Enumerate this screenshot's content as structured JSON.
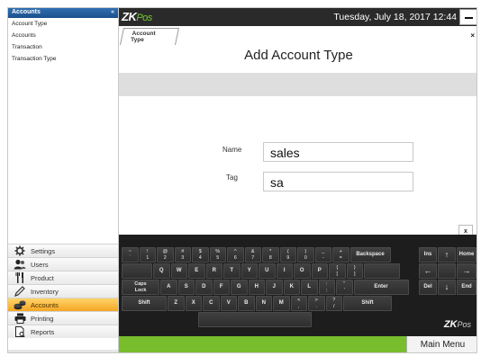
{
  "sidebar": {
    "title": "Accounts",
    "collapse_glyph": "«",
    "links": [
      "Account Type",
      "Accounts",
      "Transaction",
      "Transaction Type"
    ],
    "nav": [
      {
        "label": "Settings",
        "icon": "gear-icon",
        "active": false
      },
      {
        "label": "Users",
        "icon": "users-icon",
        "active": false
      },
      {
        "label": "Product",
        "icon": "fork-knife-icon",
        "active": false
      },
      {
        "label": "Inventory",
        "icon": "pencil-icon",
        "active": false
      },
      {
        "label": "Accounts",
        "icon": "coins-icon",
        "active": true
      },
      {
        "label": "Printing",
        "icon": "printer-icon",
        "active": false
      },
      {
        "label": "Reports",
        "icon": "report-icon",
        "active": false
      }
    ]
  },
  "topbar": {
    "logo_main": "ZK",
    "logo_accent": "Pos",
    "datetime": "Tuesday, July 18, 2017 12:44"
  },
  "content": {
    "tab_label_1": "Account",
    "tab_label_2": "Type",
    "close_tab": "×",
    "title": "Add Account Type",
    "name_label": "Name",
    "name_value": "sales",
    "tag_label": "Tag",
    "tag_value": "sa",
    "x_button": "x"
  },
  "keyboard": {
    "row1": [
      [
        "~",
        "`"
      ],
      [
        "!",
        "1"
      ],
      [
        "@",
        "2"
      ],
      [
        "#",
        "3"
      ],
      [
        "$",
        "4"
      ],
      [
        "%",
        "5"
      ],
      [
        "^",
        "6"
      ],
      [
        "&",
        "7"
      ],
      [
        "*",
        "8"
      ],
      [
        "(",
        "9"
      ],
      [
        ")",
        "0"
      ],
      [
        "_",
        "-"
      ],
      [
        "+",
        "="
      ]
    ],
    "row2": [
      "Q",
      "W",
      "E",
      "R",
      "T",
      "Y",
      "U",
      "I",
      "O",
      "P",
      [
        "{",
        "["
      ],
      [
        "}",
        "]"
      ]
    ],
    "row3": [
      "A",
      "S",
      "D",
      "F",
      "G",
      "H",
      "J",
      "K",
      "L",
      [
        ":",
        ";"
      ],
      [
        "\"",
        "'"
      ]
    ],
    "row4": [
      "Z",
      "X",
      "C",
      "V",
      "B",
      "N",
      "M",
      [
        "<",
        ","
      ],
      [
        ">",
        "."
      ],
      [
        "?",
        "/"
      ]
    ],
    "backspace": "Backspace",
    "caps_line1": "Caps",
    "caps_line2": "Lock",
    "enter": "Enter",
    "shift": "Shift",
    "ins": "Ins",
    "home": "Home",
    "del": "Del",
    "end": "End",
    "up": "↑",
    "down": "↓",
    "left": "←",
    "right": "→",
    "logo_main": "ZK",
    "logo_accent": "Pos"
  },
  "bottombar": {
    "main_menu": "Main Menu"
  },
  "colors": {
    "topbar": "#2a2a2a",
    "sidebar_header": "#1c4f8c",
    "active_nav": "#f5a623",
    "bottombar": "#78bd2c",
    "logo_accent": "#74c934"
  }
}
